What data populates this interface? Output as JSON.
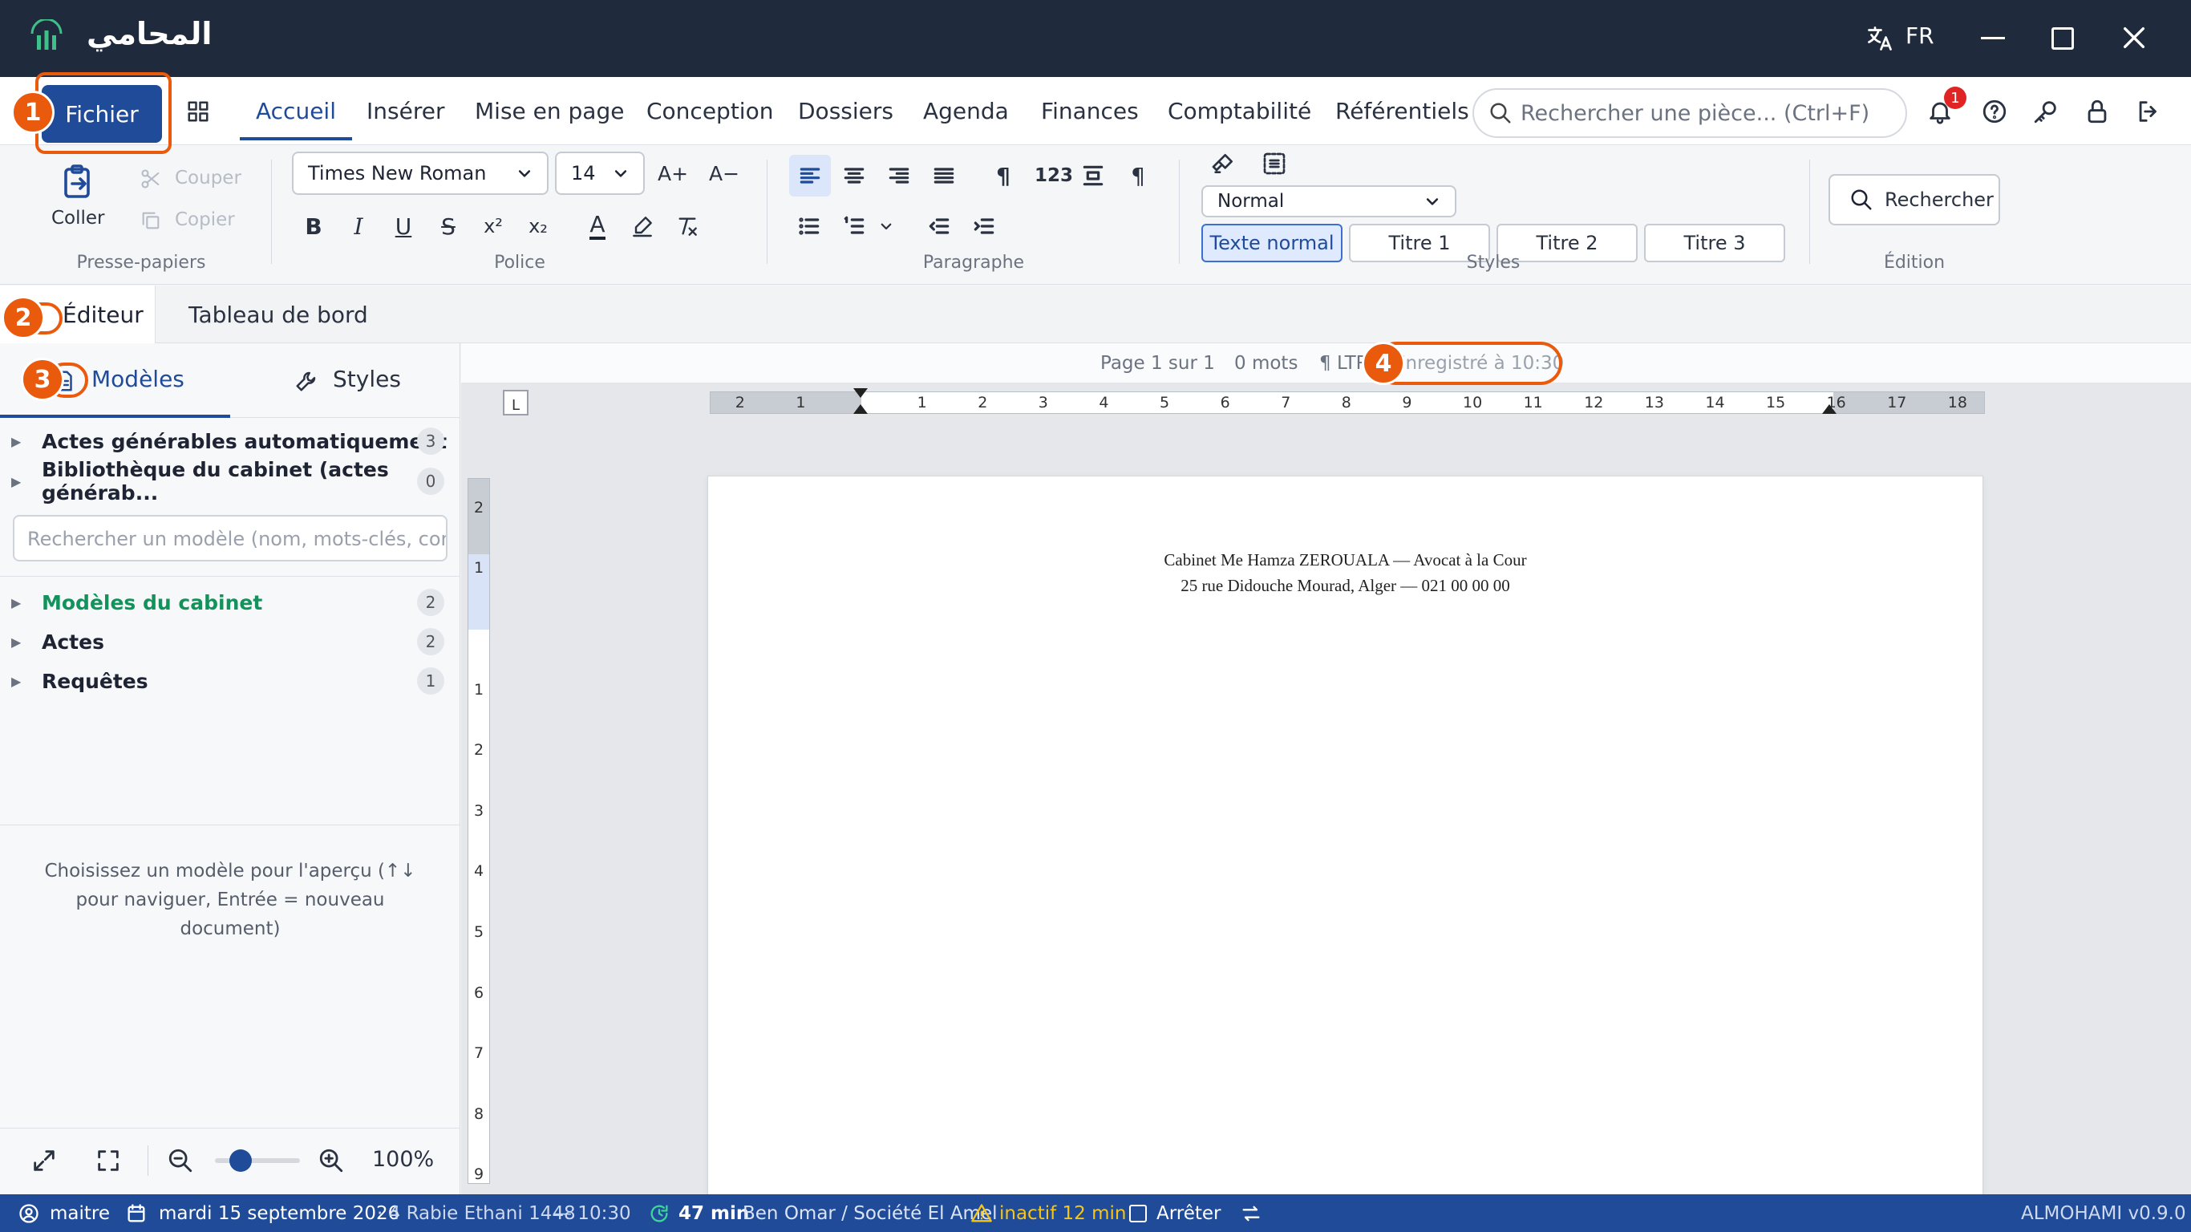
{
  "app": {
    "title": "المحامي",
    "lang": "FR"
  },
  "tabs": {
    "file": "Fichier",
    "items": [
      "Accueil",
      "Insérer",
      "Mise en page",
      "Conception",
      "Dossiers",
      "Agenda",
      "Finances",
      "Comptabilité",
      "Référentiels"
    ],
    "search_placeholder": "Rechercher une pièce... (Ctrl+F)",
    "notifications": "1"
  },
  "ribbon": {
    "paste": "Coller",
    "cut": "Couper",
    "copy": "Copier",
    "group_clipboard": "Presse-papiers",
    "font_name": "Times New Roman",
    "font_size": "14",
    "grow": "A+",
    "shrink": "A−",
    "group_font": "Police",
    "numbers": "123",
    "group_paragraph": "Paragraphe",
    "style_select": "Normal",
    "styles": [
      "Texte normal",
      "Titre 1",
      "Titre 2",
      "Titre 3"
    ],
    "group_styles": "Styles",
    "search_btn": "Rechercher",
    "group_edit": "Édition"
  },
  "view_tabs": [
    "Éditeur",
    "Tableau de bord"
  ],
  "left_panel": {
    "tabs": [
      "Modèles",
      "Styles"
    ],
    "tree_top": [
      {
        "label": "Actes générables automatiquement",
        "count": "3"
      },
      {
        "label": "Bibliothèque du cabinet (actes générab...",
        "count": "0"
      }
    ],
    "search_placeholder": "Rechercher un modèle (nom, mots-clés, con",
    "tree_bottom": [
      {
        "label": "Modèles du cabinet",
        "count": "2"
      },
      {
        "label": "Actes",
        "count": "2"
      },
      {
        "label": "Requêtes",
        "count": "1"
      }
    ],
    "hint": "Choisissez un modèle pour l'aperçu (↑↓ pour naviguer, Entrée = nouveau document)",
    "zoom": "100%",
    "zoom_level": 0.3
  },
  "doc_status": {
    "page": "Page 1 sur 1",
    "words": "0 mots",
    "dir": "¶ LTR",
    "saved": "Enregistré à 10:30"
  },
  "ruler": {
    "h": [
      "2",
      "1",
      "1",
      "2",
      "3",
      "4",
      "5",
      "6",
      "7",
      "8",
      "9",
      "10",
      "11",
      "12",
      "13",
      "14",
      "15",
      "16",
      "17",
      "18"
    ],
    "v": [
      "2",
      "1",
      "1",
      "2",
      "3",
      "4",
      "5",
      "6",
      "7",
      "8",
      "9"
    ]
  },
  "document": {
    "line1": "Cabinet Me Hamza ZEROUALA — Avocat à la Cour",
    "line2": "25 rue Didouche Mourad, Alger — 021 00 00 00"
  },
  "status_bar": {
    "user": "maitre",
    "date": "mardi 15 septembre 2026",
    "hijri": "· 4 Rabie Ethani 1448",
    "time": "— 10:30",
    "timer": "47 min",
    "client": "Ben Omar / Société El Amel",
    "inactive": "inactif 12 min",
    "stop": "Arrêter",
    "version": "ALMOHAMI v0.9.0"
  },
  "markers": [
    "1",
    "2",
    "3",
    "4"
  ],
  "colors": {
    "accent": "#1f4b99",
    "marker": "#ea5a0c",
    "titlebar": "#1f2a3c",
    "green": "#12935b"
  }
}
